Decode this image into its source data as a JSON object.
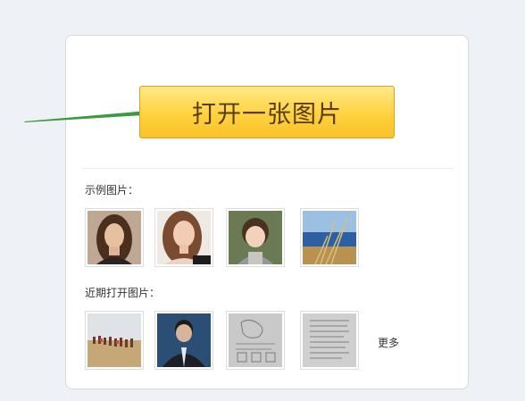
{
  "main": {
    "open_button_label": "打开一张图片",
    "sample_label": "示例图片：",
    "recent_label": "近期打开图片：",
    "more_label": "更多"
  },
  "icons": {
    "arrow": "arrow-right-icon"
  },
  "colors": {
    "button_top": "#ffe98a",
    "button_bottom": "#f9c22a",
    "button_text": "#5a3b12",
    "arrow": "#3a9a3f",
    "page_bg": "#eef1f6"
  }
}
